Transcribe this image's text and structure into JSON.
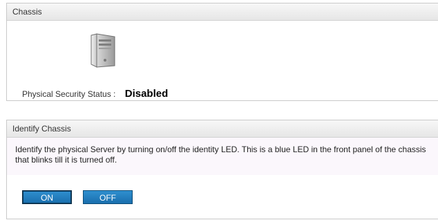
{
  "chassis": {
    "title": "Chassis",
    "icon": "server-tower-icon",
    "security_label": "Physical Security Status :",
    "security_value": "Disabled"
  },
  "identify": {
    "title": "Identify Chassis",
    "description": "Identify the physical Server by turning on/off the identity LED. This is a blue LED in the front panel of the chassis that blinks till it is turned off.",
    "on_label": "ON",
    "off_label": "OFF"
  },
  "colors": {
    "button_blue": "#1f7bbf",
    "body_tint": "#fbf7fc"
  }
}
